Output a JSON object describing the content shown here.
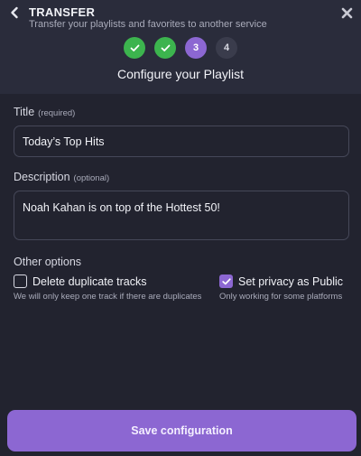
{
  "header": {
    "title": "TRANSFER",
    "subtitle": "Transfer your playlists and favorites to another service",
    "steps": [
      {
        "label": "",
        "state": "done"
      },
      {
        "label": "",
        "state": "done"
      },
      {
        "label": "3",
        "state": "active"
      },
      {
        "label": "4",
        "state": "pending"
      }
    ],
    "heading": "Configure your Playlist"
  },
  "form": {
    "title_label": "Title",
    "title_hint": "(required)",
    "title_value": "Today’s Top Hits",
    "description_label": "Description",
    "description_hint": "(optional)",
    "description_value": "Noah Kahan is on top of the Hottest 50!"
  },
  "options": {
    "section_label": "Other options",
    "delete_duplicates": {
      "label": "Delete duplicate tracks",
      "note": "We will only keep one track if there are duplicates",
      "checked": false
    },
    "privacy_public": {
      "label": "Set privacy as Public",
      "note": "Only working for some platforms",
      "checked": true
    }
  },
  "save_label": "Save configuration",
  "colors": {
    "accent": "#8c67d2",
    "success": "#3cb44e",
    "background": "#22232f",
    "header_background": "#2a2c3b"
  },
  "icons": [
    "chevron-left-icon",
    "close-icon",
    "check-icon"
  ]
}
